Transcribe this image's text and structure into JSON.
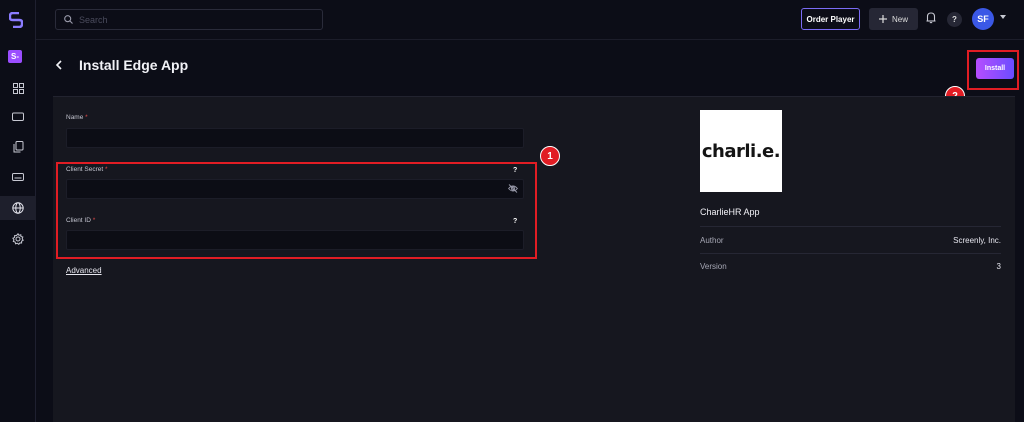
{
  "sidebar": {
    "workspace_badge": "S-",
    "items": [
      {
        "icon": "dashboard-grid-icon"
      },
      {
        "icon": "screen-icon"
      },
      {
        "icon": "files-icon"
      },
      {
        "icon": "device-icon"
      },
      {
        "icon": "globe-icon",
        "active": true
      },
      {
        "icon": "settings-icon"
      }
    ]
  },
  "topbar": {
    "search_placeholder": "Search",
    "order_player_label": "Order Player",
    "new_label": "New",
    "help_label": "?",
    "avatar_initials": "SF"
  },
  "page": {
    "title": "Install Edge App",
    "install_label": "Install"
  },
  "form": {
    "name_label": "Name",
    "client_secret_label": "Client Secret",
    "client_id_label": "Client ID",
    "required_mark": "*",
    "help_mark": "?",
    "advanced_label": "Advanced"
  },
  "app": {
    "logo_text": "charli.e.",
    "name": "CharlieHR App",
    "author_label": "Author",
    "author_value": "Screenly, Inc.",
    "version_label": "Version",
    "version_value": "3"
  },
  "callouts": {
    "one": "1",
    "two": "2"
  },
  "colors": {
    "accent": "#7b6cf6",
    "install_gradient_start": "#b64dff",
    "install_gradient_end": "#6b4dff",
    "highlight_red": "#e11d24",
    "avatar_blue": "#3b58e6"
  }
}
